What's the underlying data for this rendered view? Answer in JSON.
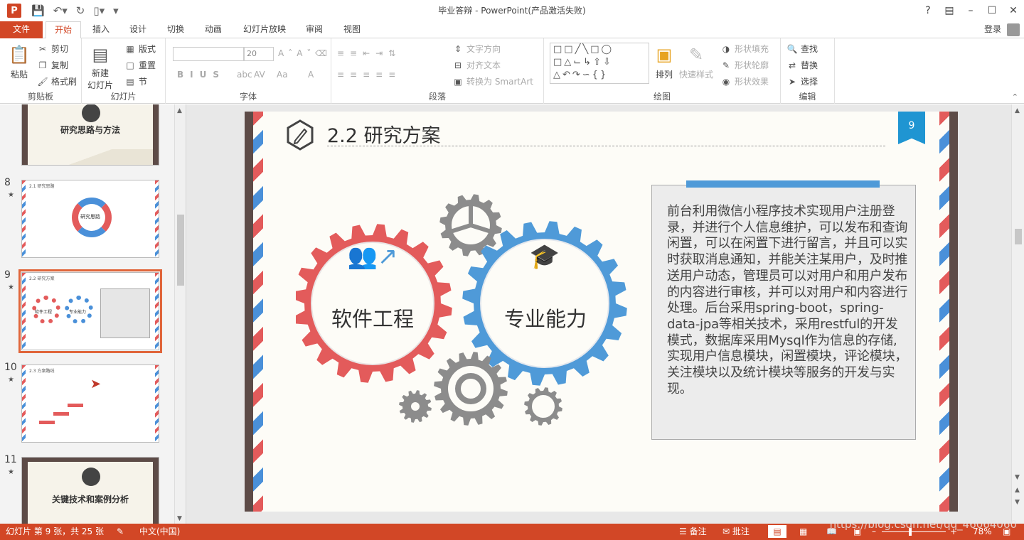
{
  "window": {
    "title": "毕业答辩 - PowerPoint(产品激活失败)",
    "help": "?",
    "app_logo": "P"
  },
  "tabs": [
    {
      "label": "文件"
    },
    {
      "label": "开始"
    },
    {
      "label": "插入"
    },
    {
      "label": "设计"
    },
    {
      "label": "切换"
    },
    {
      "label": "动画"
    },
    {
      "label": "幻灯片放映"
    },
    {
      "label": "审阅"
    },
    {
      "label": "视图"
    }
  ],
  "login_label": "登录",
  "ribbon": {
    "clipboard": {
      "label": "剪贴板",
      "paste": "粘贴",
      "cut": "剪切",
      "copy": "复制",
      "format_painter": "格式刷"
    },
    "slides": {
      "label": "幻灯片",
      "new_slide_line1": "新建",
      "new_slide_line2": "幻灯片",
      "layout": "版式",
      "reset": "重置",
      "section": "节"
    },
    "font": {
      "label": "字体",
      "font_name": "",
      "font_size": "20"
    },
    "paragraph": {
      "label": "段落",
      "text_direction": "文字方向",
      "align_text": "对齐文本",
      "smartart": "转换为 SmartArt"
    },
    "drawing": {
      "label": "绘图",
      "arrange": "排列",
      "quick_styles": "快速样式",
      "shape_fill": "形状填充",
      "shape_outline": "形状轮廓",
      "shape_effects": "形状效果"
    },
    "editing": {
      "label": "编辑",
      "find": "查找",
      "replace": "替换",
      "select": "选择"
    }
  },
  "thumbnails": [
    {
      "number": "",
      "title": "研究思路与方法"
    },
    {
      "number": "8",
      "title": "2.1 研究思路",
      "center": "研究思路"
    },
    {
      "number": "9",
      "title": "2.2 研究方案",
      "left": "软件工程",
      "right": "专业能力"
    },
    {
      "number": "10",
      "title": "2.3 方案路线"
    },
    {
      "number": "11",
      "title": "关键技术和案例分析"
    }
  ],
  "slide": {
    "title": "2.2 研究方案",
    "page_number": "9",
    "gear_left_label": "软件工程",
    "gear_right_label": "专业能力",
    "body_text": "前台利用微信小程序技术实现用户注册登录，并进行个人信息维护，可以发布和查询闲置，可以在闲置下进行留言，并且可以实时获取消息通知，并能关注某用户，及时推送用户动态，管理员可以对用户和用户发布的内容进行审核，并可以对用户和内容进行处理。后台采用spring-boot，spring-data-jpa等相关技术，采用restful的开发模式，数据库采用Mysql作为信息的存储,实现用户信息模块，闲置模块，评论模块，关注模块以及统计模块等服务的开发与实现。",
    "colors": {
      "red_gear": "#e35b5b",
      "blue_gear": "#4f9ad8",
      "grey_gear": "#8c8c8c",
      "accent": "#1f95d2"
    }
  },
  "status": {
    "slide_info": "幻灯片 第 9 张，共 25 张",
    "language": "中文(中国)",
    "notes": "备注",
    "comments": "批注",
    "zoom": "78%"
  },
  "watermark": "https://blog.csdn.net/qq_46064060"
}
